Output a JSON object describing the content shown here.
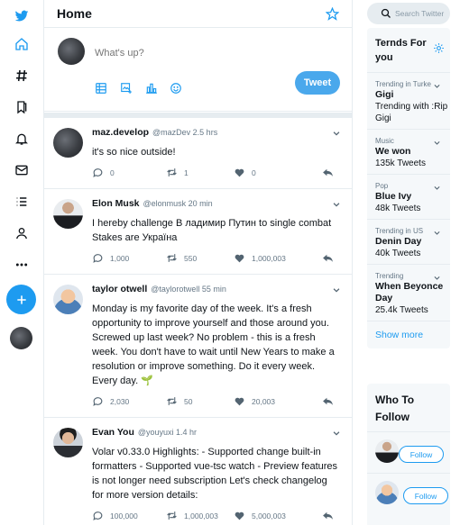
{
  "colors": {
    "accent": "#1d9bf0",
    "tweet_button": "#4aa8ec",
    "muted": "#657786"
  },
  "nav": {
    "items": [
      {
        "icon": "twitter-logo-icon"
      },
      {
        "icon": "home-icon"
      },
      {
        "icon": "hashtag-icon"
      },
      {
        "icon": "bookmark-icon"
      },
      {
        "icon": "bell-icon"
      },
      {
        "icon": "mail-icon"
      },
      {
        "icon": "list-icon"
      },
      {
        "icon": "profile-icon"
      },
      {
        "icon": "more-icon"
      }
    ],
    "compose_icon": "plus-icon"
  },
  "header": {
    "title": "Home",
    "icon": "sparkle-star-icon"
  },
  "composer": {
    "placeholder": "What's up?",
    "tweet_label": "Tweet",
    "tools": [
      "image-icon",
      "gif-icon",
      "poll-icon",
      "emoji-icon"
    ]
  },
  "tweets": [
    {
      "name": "maz.develop",
      "meta": "@mazDev 2.5 hrs",
      "text": "it's so nice outside!",
      "replies": "0",
      "retweets": "1",
      "likes": "0"
    },
    {
      "name": "Elon Musk",
      "meta": "@elonmusk 20 min",
      "text": "I hereby challenge В ладимир Путин to single combat Stakes are Україна",
      "replies": "1,000",
      "retweets": "550",
      "likes": "1,000,003"
    },
    {
      "name": "taylor otwell",
      "meta": "@taylorotwell 55 min",
      "text": "Monday is my favorite day of the week. It's a fresh opportunity to improve yourself and those around you. Screwed up last week? No problem - this is a fresh week. You don't have to wait until New Years to make a resolution or improve something. Do it every week. Every day. 🌱",
      "replies": "2,030",
      "retweets": "50",
      "likes": "20,003"
    },
    {
      "name": "Evan You",
      "meta": "@youyuxi 1.4 hr",
      "text": "Volar v0.33.0 Highlights: - Supported change built-in formatters - Supported vue-tsc watch - Preview features is not longer need subscription Let's check changelog for more version details:",
      "replies": "100,000",
      "retweets": "1,000,003",
      "likes": "5,000,003"
    }
  ],
  "search": {
    "placeholder": "Search Twitter"
  },
  "trends": {
    "title": "Ternds For you",
    "items": [
      {
        "category": "Trending in Turkey",
        "name": "Gigi",
        "count": "Trending with :Rip Gigi"
      },
      {
        "category": "Music",
        "name": "We won",
        "count": "135k Tweets"
      },
      {
        "category": "Pop",
        "name": "Blue Ivy",
        "count": "48k Tweets"
      },
      {
        "category": "Trending in US",
        "name": "Denin Day",
        "count": "40k Tweets"
      },
      {
        "category": "Trending",
        "name": "When Beyonce Day",
        "count": "25.4k Tweets"
      }
    ],
    "show_more": "Show more"
  },
  "who_to_follow": {
    "title": "Who To Follow",
    "follow_label": "Follow"
  }
}
